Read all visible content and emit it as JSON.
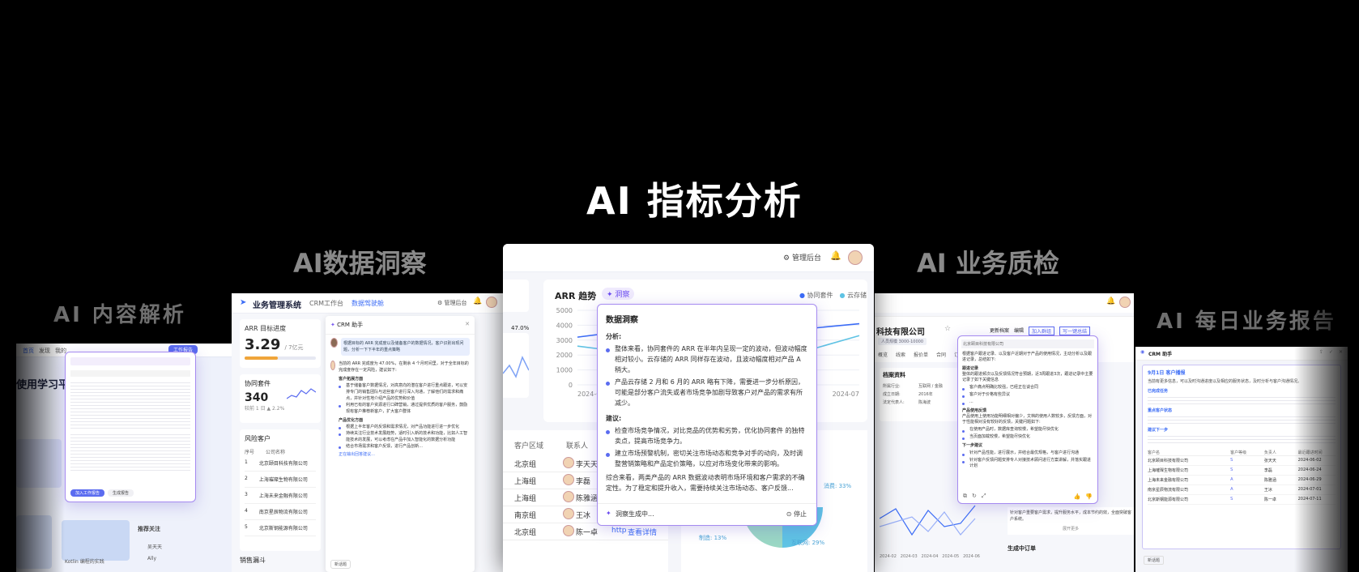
{
  "headings": {
    "main": "AI 指标分析",
    "left": "AI数据洞察",
    "right": "AI 业务质检",
    "far_left": "AI 内容解析",
    "far_right": "AI 每日业务报告"
  },
  "center": {
    "admin_label": "管理后台",
    "chart_title": "ARR 趋势",
    "insight_tag": "洞察",
    "legend": [
      "协同套件",
      "云存储"
    ],
    "y_ticks": [
      "5000",
      "4000",
      "3000",
      "2000",
      "1000",
      "0"
    ],
    "x_ticks": [
      "2024-01",
      "2024-07"
    ],
    "insight": {
      "title": "数据洞察",
      "analysis_label": "分析:",
      "analysis": [
        "整体来看，协同套件的 ARR 在半年内呈现一定的波动，但波动幅度相对较小。云存储的 ARR 同样存在波动，且波动幅度相对产品 A 稍大。",
        "产品云存储 2 月和 6 月的 ARR 略有下降，需要进一步分析原因，可能是部分客户流失或者市场竞争加剧导致客户对产品的需求有所减少。"
      ],
      "advice_label": "建议:",
      "advice": [
        "检查市场竞争情况，对比竞品的优势和劣势，优化协同套件 的独特卖点，提高市场竞争力。",
        "建立市场预警机制，密切关注市场动态和竞争对手的动向，及时调整营销策略和产品定价策略，以应对市场变化带来的影响。"
      ],
      "summary": "综合来看，两类产品的 ARR 数据波动表明市场环境和客户需求的不确定性。为了稳定和提升收入，需要持续关注市场动态、客户反馈...",
      "generating": "洞察生成中...",
      "stop": "停止"
    },
    "table": {
      "headers": [
        "客户区域",
        "联系人"
      ],
      "rows": [
        {
          "region": "北京组",
          "contact": "李天天"
        },
        {
          "region": "上海组",
          "contact": "李磊"
        },
        {
          "region": "上海组",
          "contact": "陈雅涵"
        },
        {
          "region": "南京组",
          "contact": "王冰"
        },
        {
          "region": "北京组",
          "contact": "陈一卓"
        }
      ],
      "action": "查看详情",
      "link_prefix": "http"
    },
    "pie": {
      "labels": [
        "消费: 33%",
        "制造: 13%",
        "互联网: 29%"
      ]
    },
    "percent_label": "47.0%"
  },
  "left": {
    "app_title": "业务管理系统",
    "nav": [
      "CRM工作台",
      "数据驾驶舱"
    ],
    "admin_label": "管理后台",
    "arr_title": "ARR 目标进度",
    "arr_value": "3.29",
    "arr_unit": "/ 7亿元",
    "suite_title": "协同套件",
    "suite_value": "340",
    "suite_change": "较前 1 日 ▲ 2.2%",
    "risk_title": "风险客户",
    "risk_headers": [
      "序号",
      "公司名称"
    ],
    "risk_rows": [
      {
        "no": "1",
        "name": "北京颐目科技有限公司"
      },
      {
        "no": "2",
        "name": "上海璀璨生物有限公司"
      },
      {
        "no": "3",
        "name": "上海未来金融有限公司"
      },
      {
        "no": "4",
        "name": "南京星辰物流有限公司"
      },
      {
        "no": "5",
        "name": "北京斯钢能源有限公司"
      }
    ],
    "funnel_title": "销售漏斗",
    "assistant_title": "CRM 助手",
    "user_msg": "根据目标的 ARR 完成度以及储备客户的数据情况，客户识别出现问题，分析一下下半年的重点策略",
    "reply_intro": "当前的 ARR 完成度为 47.00%，在剩余 4 个月时间里，对于全年目标的完成度存在一定风险，建议如下:",
    "sections": [
      {
        "title": "客户拓展方面",
        "items": [
          "基于储备客户数据情况，对高意向的潜在客户进行重点跟进，可以安排专门的销售团队与这些客户进行深入沟通，了解他们的需求和痛点，并针对性地介绍产品的优势和价值",
          "利用已有的客户资源进行口碑营销，通过提供优质的客户服务，鼓励现有客户推荐新客户，扩大客户群体"
        ]
      },
      {
        "title": "产品优化方面",
        "items": [
          "根据上半年客户的反馈和需求情况，对产品功能进行进一步优化",
          "持续关注行业技术发展趋势，适时引入新的技术和功能，比如人工智能技术的发展，可以考虑在产品中加入智能化的数据分析功能",
          "结合市场需求和客户反馈，进行产品创新..."
        ]
      }
    ],
    "typing": "正在输出回答建议...",
    "new_chat": "新话题"
  },
  "right": {
    "company": "科技有限公司",
    "tag": "人员规模 3000-10000",
    "actions": [
      "更新档案",
      "编辑",
      "加入群组",
      "写一键总结"
    ],
    "tabs": [
      "概览",
      "线索",
      "报价单",
      "合同",
      "订单"
    ],
    "profile_title": "档案资料",
    "profile_rows": [
      {
        "label": "所属行业:",
        "value": "互联网 / 金融"
      },
      {
        "label": "成立日期:",
        "value": "2016年"
      },
      {
        "label": "法定代表人:",
        "value": "陈海波"
      }
    ],
    "panel_header": "北京颐目科技有限公司",
    "panel_intro": "根据客户跟进记录、以及客户近期对于产品的使用情况，主动分析以及跟进记录，总结如下:",
    "followup_title": "跟进记录",
    "followup_text": "整体的跟进频次以及反馈情况符合预期，近3周跟进3次，跟进记录中主要记录了如下关键信息",
    "followup_items": [
      "客户痛点明确比较强，已经正在谈合同",
      "客户对于价格有些异议",
      "..."
    ],
    "usage_title": "产品使用反馈",
    "usage_text": "产品使用上使用功能明细相对偏少，文档的使用人数较多，反馈方面，对于性能相对没有较好的反馈，关键问题如下:",
    "usage_items": [
      "在使用产品时，数据库查询较慢，希望能尽快优化",
      "当页面加载较慢，希望能尽快优化"
    ],
    "next_title": "下一步建议",
    "next_items": [
      "针对产品性能，进行展示，并结合最优规格，与客户进行沟通",
      "针对客户反馈问题安排专人对接技术顾问进行方案讲解，并落实跟进计划"
    ],
    "bottom_text": "针对客户重要客户需求，提升服务水平，成本节约的效，全面突破客户系统。",
    "expand": "展开更多",
    "order_title": "生成中订单",
    "chart_x": [
      "2024-02",
      "2024-03",
      "2024-04",
      "2024-05",
      "2024-06"
    ]
  },
  "far_left": {
    "card_title": "使用学习平台",
    "tab_label": "工作报告",
    "brand_title": "Kotlin 编程的实践",
    "recommend_title": "推荐关注",
    "recommend_items": [
      "吴天天",
      "Ally"
    ],
    "buttons": [
      "加入工作报告",
      "生成报告"
    ]
  },
  "far_right": {
    "title": "CRM 助手",
    "report_title": "9月1日 客户播报",
    "report_intro": "当前有更多信息，可以及时沟通进度以及相应的服务状态，及时分析与客户沟通情况。",
    "sections": [
      "已完成任务",
      "重点客户状态",
      "建议下一步"
    ],
    "table_headers": [
      "客户名",
      "客户等级",
      "负责人",
      "最近跟进时间"
    ],
    "table_rows": [
      {
        "name": "北京颐目科技有限公司",
        "level": "S",
        "owner": "张天天",
        "date": "2024-06-02"
      },
      {
        "name": "上海璀璨生物有限公司",
        "level": "S",
        "owner": "李磊",
        "date": "2024-06-24"
      },
      {
        "name": "上海未来金融有限公司",
        "level": "A",
        "owner": "陈雅涵",
        "date": "2024-06-29"
      },
      {
        "name": "南京星辰物流有限公司",
        "level": "A",
        "owner": "王冰",
        "date": "2024-07-01"
      },
      {
        "name": "北京斯钢能源有限公司",
        "level": "S",
        "owner": "陈一卓",
        "date": "2024-07-11"
      }
    ],
    "footer": "新话题"
  },
  "chart_data": {
    "type": "line",
    "title": "ARR 趋势",
    "series": [
      {
        "name": "协同套件",
        "values": [
          3200,
          3600,
          3400,
          3900,
          3500,
          3800,
          4100
        ]
      },
      {
        "name": "云存储",
        "values": [
          2600,
          2200,
          2900,
          2500,
          3000,
          2400,
          3300
        ]
      }
    ],
    "categories": [
      "2024-01",
      "2024-02",
      "2024-03",
      "2024-04",
      "2024-05",
      "2024-06",
      "2024-07"
    ],
    "ylim": [
      0,
      5000
    ]
  }
}
